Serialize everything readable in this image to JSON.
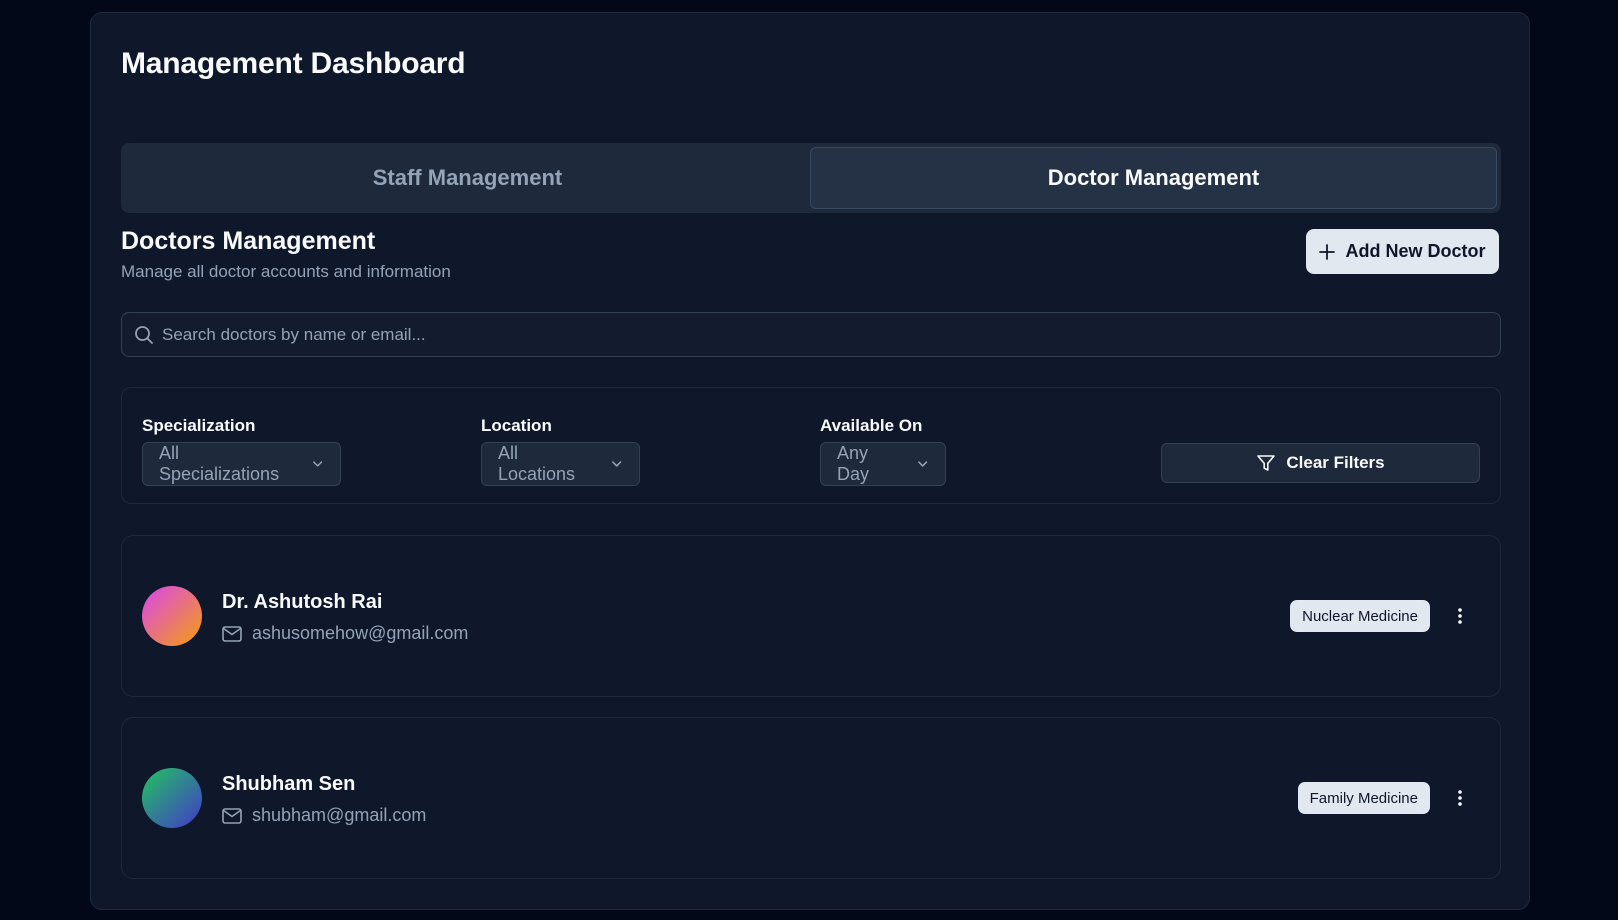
{
  "page": {
    "title": "Management Dashboard"
  },
  "tabs": [
    {
      "label": "Staff Management",
      "active": false
    },
    {
      "label": "Doctor Management",
      "active": true
    }
  ],
  "section": {
    "title": "Doctors Management",
    "subtitle": "Manage all doctor accounts and information",
    "add_button": "Add New Doctor"
  },
  "search": {
    "placeholder": "Search doctors by name or email...",
    "value": ""
  },
  "filters": {
    "specialization": {
      "label": "Specialization",
      "value": "All Specializations"
    },
    "location": {
      "label": "Location",
      "value": "All Locations"
    },
    "available_on": {
      "label": "Available On",
      "value": "Any Day"
    },
    "clear_button": "Clear Filters"
  },
  "doctors": [
    {
      "name": "Dr. Ashutosh Rai",
      "email": "ashusomehow@gmail.com",
      "specialization": "Nuclear Medicine",
      "avatar_gradient": [
        "#d946ef",
        "#f59e0b"
      ]
    },
    {
      "name": "Shubham Sen",
      "email": "shubham@gmail.com",
      "specialization": "Family Medicine",
      "avatar_gradient": [
        "#22c55e",
        "#4338ca"
      ]
    }
  ],
  "colors": {
    "background": "#020817",
    "card": "#0f172a",
    "border": "#1e293b",
    "muted_text": "#94a3b8",
    "primary_button": "#e2e8f0"
  }
}
